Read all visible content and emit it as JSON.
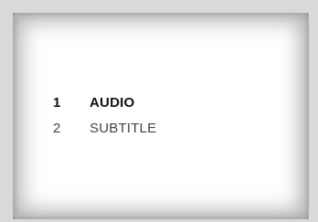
{
  "menu": {
    "items": [
      {
        "number": "1",
        "label": "AUDIO",
        "selected": true
      },
      {
        "number": "2",
        "label": "SUBTITLE",
        "selected": false
      }
    ]
  },
  "colors": {
    "background": "#d9d9d9",
    "panel": "#ffffff",
    "text_selected": "#111111",
    "text_normal": "#444444"
  }
}
